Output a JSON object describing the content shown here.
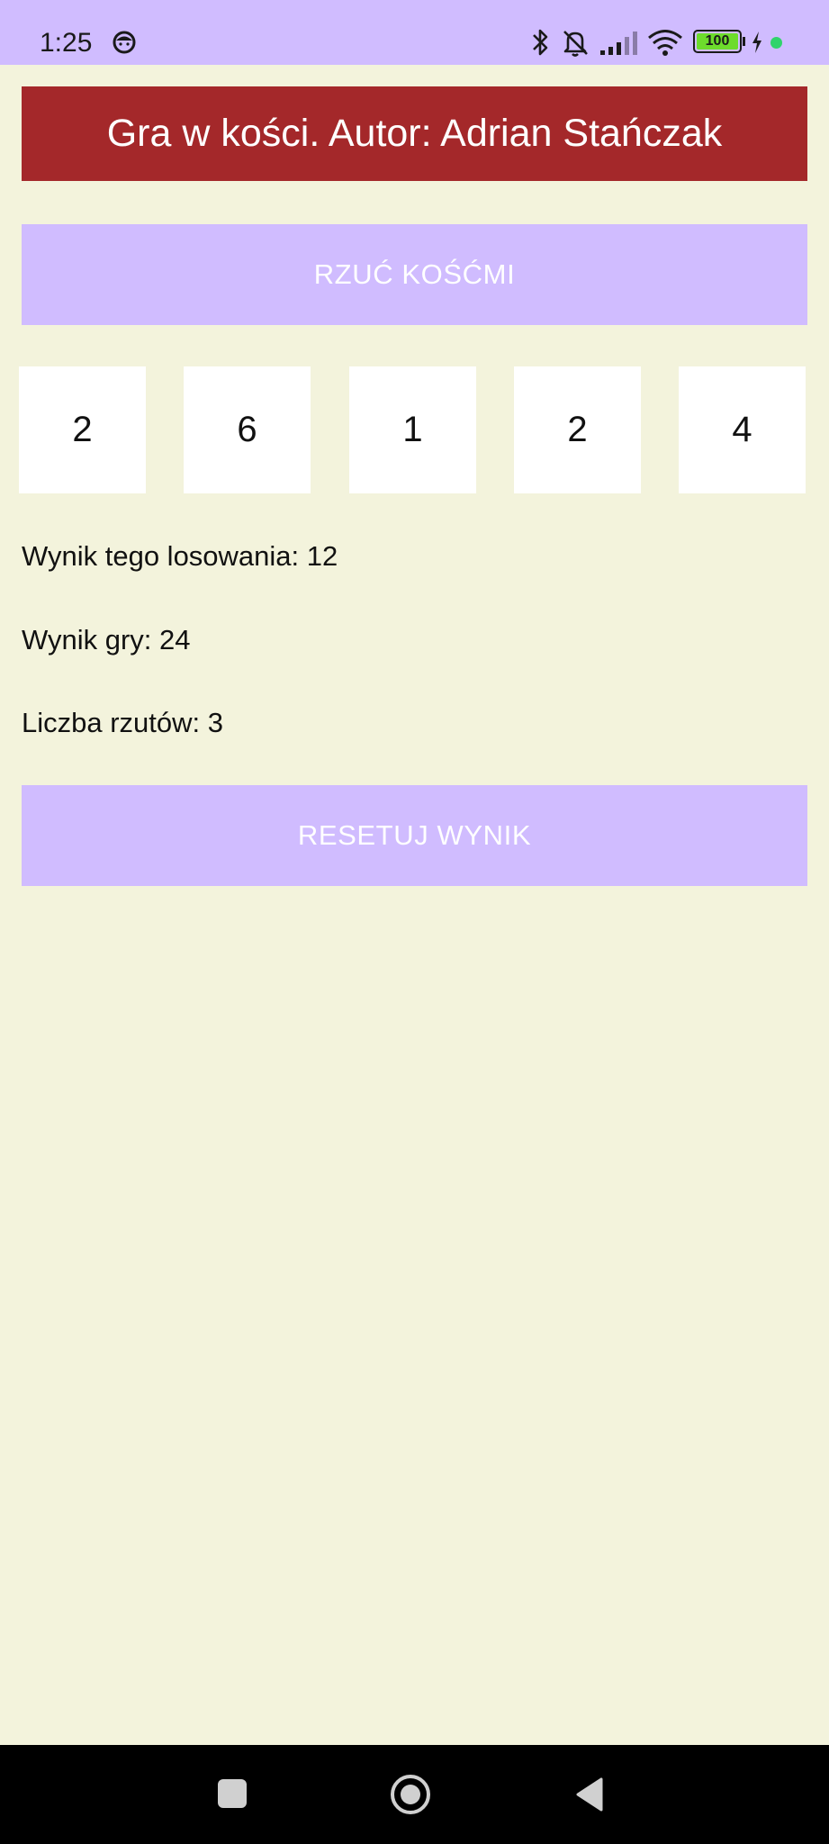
{
  "status_bar": {
    "time": "1:25",
    "battery_level": "100",
    "icons": [
      "face-icon",
      "bluetooth-icon",
      "bell-off-icon",
      "signal-icon",
      "wifi-icon",
      "battery-icon",
      "charging-icon",
      "privacy-dot-icon"
    ],
    "colors": {
      "background": "#d0bcff",
      "battery_fill": "#6ddc2c",
      "privacy_dot": "#2fd46b"
    }
  },
  "app": {
    "title": "Gra w kości. Autor: Adrian Stańczak",
    "colors": {
      "background": "#f3f3dc",
      "title_bar": "#a4282a",
      "button": "#d0bcff",
      "die": "#ffffff"
    }
  },
  "roll_button": {
    "label": "RZUĆ KOŚĆMI"
  },
  "dice": [
    {
      "value": "2"
    },
    {
      "value": "6"
    },
    {
      "value": "1"
    },
    {
      "value": "2"
    },
    {
      "value": "4"
    }
  ],
  "results": {
    "roll_score": "Wynik tego losowania: 12",
    "game_score": "Wynik gry: 24",
    "roll_count": "Liczba rzutów: 3"
  },
  "reset_button": {
    "label": "RESETUJ WYNIK"
  },
  "nav_bar": {
    "icons": [
      "recents-square-icon",
      "home-circle-icon",
      "back-triangle-icon"
    ]
  }
}
